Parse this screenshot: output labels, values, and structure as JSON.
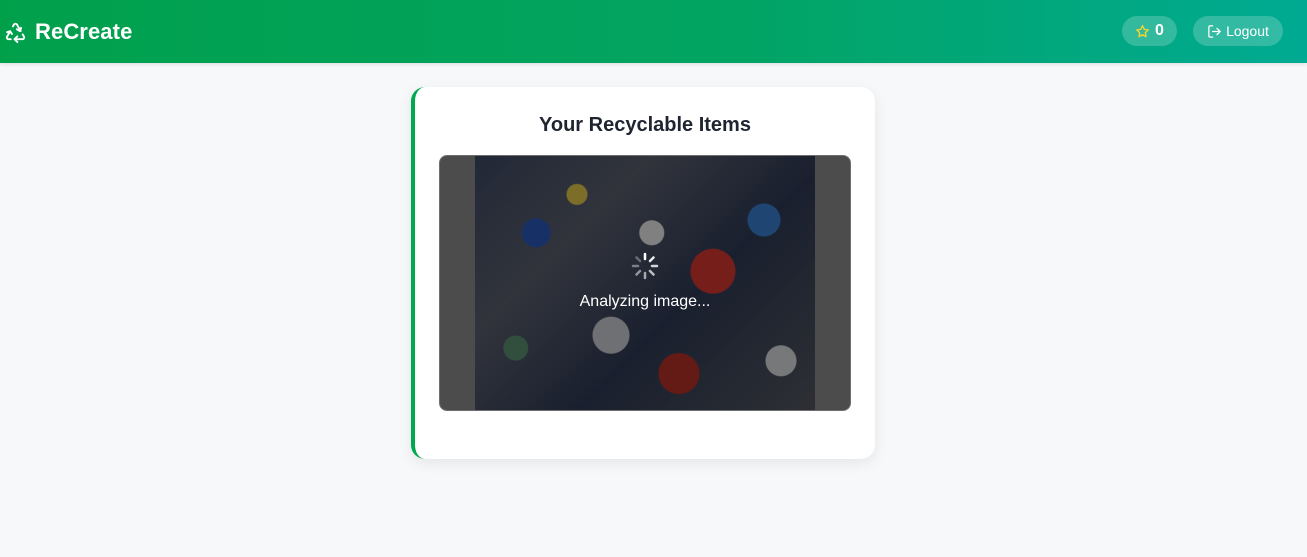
{
  "header": {
    "brand": "ReCreate",
    "points": "0",
    "logout_label": "Logout"
  },
  "card": {
    "title": "Your Recyclable Items",
    "status_text": "Analyzing image..."
  },
  "icons": {
    "brand": "recycle-icon",
    "points": "star-icon",
    "logout": "logout-icon",
    "loading": "spinner-icon"
  },
  "colors": {
    "header_start": "#00a04b",
    "header_end": "#00aa92",
    "card_accent": "#00a84f",
    "page_background": "#f6f8fa",
    "star": "#f7d531"
  }
}
